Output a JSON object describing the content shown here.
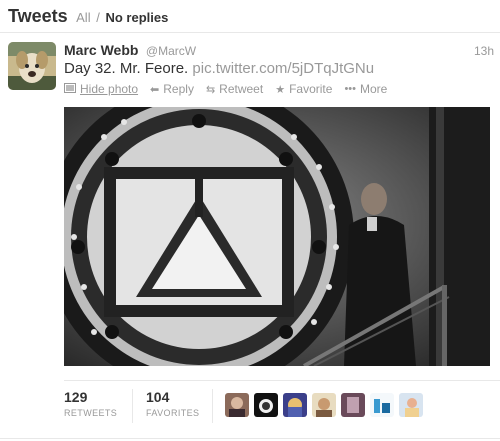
{
  "header": {
    "title": "Tweets",
    "filter_all": "All",
    "separator": "/",
    "filter_active": "No replies"
  },
  "tweet": {
    "author_name": "Marc Webb",
    "author_handle": "@MarcW",
    "time": "13h",
    "text": "Day 32. Mr. Feore.",
    "link": "pic.twitter.com/5jDTqJtGNu",
    "actions": {
      "hide_photo": "Hide photo",
      "reply": "Reply",
      "retweet": "Retweet",
      "favorite": "Favorite",
      "more": "More"
    },
    "icons": {
      "hide_photo": "photo-icon",
      "reply": "reply-icon",
      "retweet": "retweet-icon",
      "favorite": "star-icon",
      "more": "more-dots-icon"
    }
  },
  "stats": {
    "retweets_count": "129",
    "retweets_label": "RETWEETS",
    "favorites_count": "104",
    "favorites_label": "FAVORITES"
  },
  "favoriters_count": 7,
  "colors": {
    "text": "#333333",
    "muted": "#999999",
    "border": "#e8e8e8"
  }
}
